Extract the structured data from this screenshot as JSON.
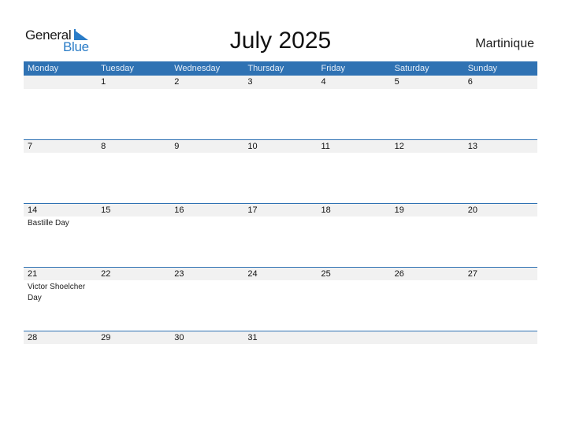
{
  "logo": {
    "word1": "General",
    "word2": "Blue"
  },
  "title": "July 2025",
  "country": "Martinique",
  "colors": {
    "header": "#2f72b3",
    "accent": "#2a7cc7",
    "daybar": "#f1f1f1"
  },
  "weekdays": [
    "Monday",
    "Tuesday",
    "Wednesday",
    "Thursday",
    "Friday",
    "Saturday",
    "Sunday"
  ],
  "weeks": [
    {
      "days": [
        "",
        "1",
        "2",
        "3",
        "4",
        "5",
        "6"
      ],
      "events": [
        "",
        "",
        "",
        "",
        "",
        "",
        ""
      ]
    },
    {
      "days": [
        "7",
        "8",
        "9",
        "10",
        "11",
        "12",
        "13"
      ],
      "events": [
        "",
        "",
        "",
        "",
        "",
        "",
        ""
      ]
    },
    {
      "days": [
        "14",
        "15",
        "16",
        "17",
        "18",
        "19",
        "20"
      ],
      "events": [
        "Bastille Day",
        "",
        "",
        "",
        "",
        "",
        ""
      ]
    },
    {
      "days": [
        "21",
        "22",
        "23",
        "24",
        "25",
        "26",
        "27"
      ],
      "events": [
        "Victor Shoelcher Day",
        "",
        "",
        "",
        "",
        "",
        ""
      ]
    },
    {
      "days": [
        "28",
        "29",
        "30",
        "31",
        "",
        "",
        ""
      ],
      "events": [
        "",
        "",
        "",
        "",
        "",
        "",
        ""
      ]
    }
  ]
}
